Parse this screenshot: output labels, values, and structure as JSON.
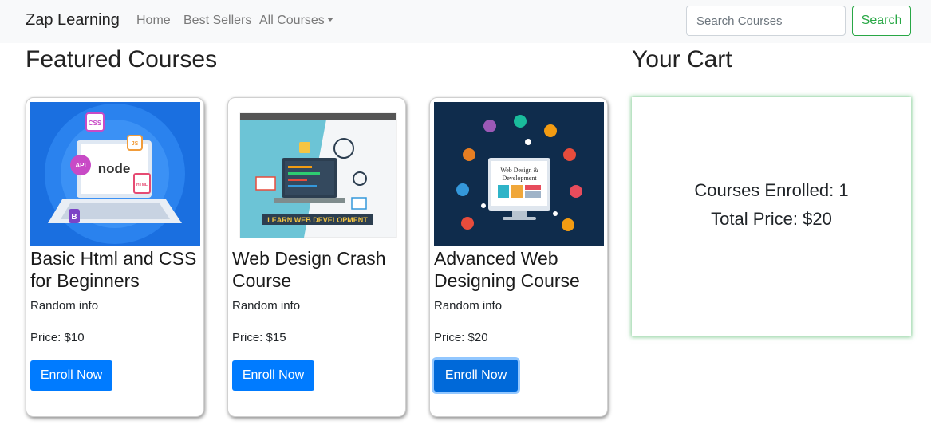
{
  "navbar": {
    "brand": "Zap Learning",
    "links": [
      "Home",
      "Best Sellers",
      "All Courses"
    ],
    "search_placeholder": "Search Courses",
    "search_button": "Search"
  },
  "featured": {
    "title": "Featured Courses",
    "courses": [
      {
        "title": "Basic Html and CSS for Beginners",
        "info": "Random info",
        "price": "Price: $10",
        "button": "Enroll Now",
        "image_icon": "laptop-node-illustration",
        "image_labels": [
          "CSS",
          "API",
          "node",
          "JS",
          "HTML",
          "B"
        ]
      },
      {
        "title": "Web Design Crash Course",
        "info": "Random info",
        "price": "Price: $15",
        "button": "Enroll Now",
        "image_icon": "web-development-illustration",
        "image_labels": [
          "LEARN WEB DEVELOPMENT"
        ]
      },
      {
        "title": "Advanced Web Designing Course",
        "info": "Random info",
        "price": "Price: $20",
        "button": "Enroll Now",
        "image_icon": "web-design-monitor-illustration",
        "image_labels": [
          "Web Design &",
          "Development"
        ]
      }
    ]
  },
  "cart": {
    "title": "Your Cart",
    "enrolled": "Courses Enrolled: 1",
    "total": "Total Price: $20"
  },
  "colors": {
    "primary": "#007bff",
    "success": "#28a745",
    "navbar_bg": "#f8f9fa"
  }
}
